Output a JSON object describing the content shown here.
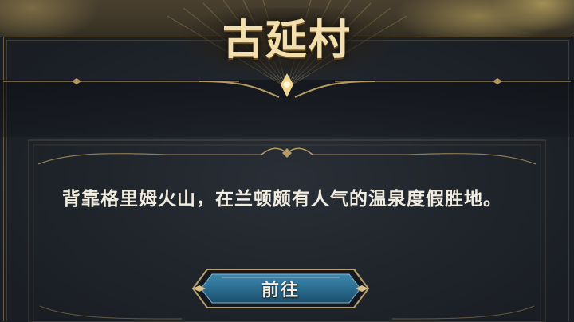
{
  "location": {
    "title": "古延村",
    "description": "背靠格里姆火山，在兰顿颇有人气的温泉度假胜地。"
  },
  "actions": {
    "go_label": "前往"
  },
  "colors": {
    "title_gold": "#f3dfad",
    "ornament_gold": "#b59a65",
    "button_blue": "#2b6d91",
    "panel_dark": "#1f242b"
  }
}
